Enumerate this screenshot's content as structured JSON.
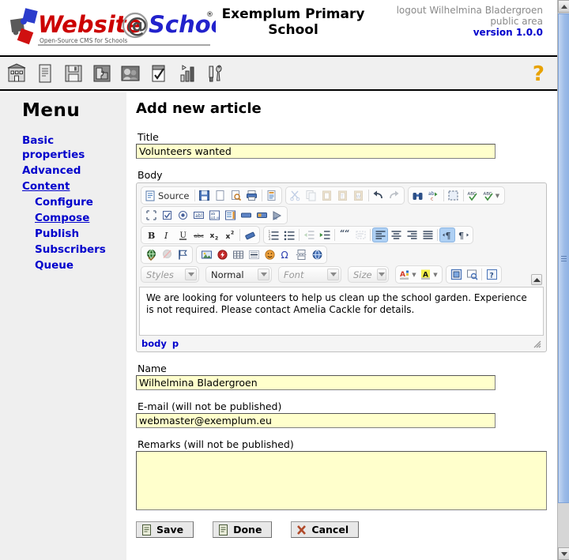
{
  "header": {
    "logo_text_1": "Website",
    "logo_at": "@",
    "logo_text_2": "School",
    "logo_tagline": "Open-Source CMS for Schools",
    "registered_mark": "®",
    "site_title": "Exemplum Primary School",
    "logout_text": "logout Wilhelmina Bladergroen",
    "area_text": "public area",
    "version_text": "version 1.0.0"
  },
  "iconbar": {
    "items": [
      {
        "name": "school-home-icon",
        "title": "School"
      },
      {
        "name": "page-icon",
        "title": "Pages"
      },
      {
        "name": "floppy-disk-icon",
        "title": "Save / Files"
      },
      {
        "name": "modules-puzzle-icon",
        "title": "Modules"
      },
      {
        "name": "users-icon",
        "title": "Users"
      },
      {
        "name": "checklist-icon",
        "title": "Tasks"
      },
      {
        "name": "statistics-icon",
        "title": "Statistics"
      },
      {
        "name": "tools-icon",
        "title": "Tools"
      }
    ],
    "help_label": "?"
  },
  "sidebar": {
    "title": "Menu",
    "items": [
      {
        "label": "Basic properties",
        "active": false,
        "sub": false
      },
      {
        "label": "Advanced",
        "active": false,
        "sub": false
      },
      {
        "label": "Content",
        "active": true,
        "sub": false
      },
      {
        "label": "Configure",
        "active": false,
        "sub": true
      },
      {
        "label": "Compose",
        "active": true,
        "sub": true
      },
      {
        "label": "Publish",
        "active": false,
        "sub": true
      },
      {
        "label": "Subscribers",
        "active": false,
        "sub": true
      },
      {
        "label": "Queue",
        "active": false,
        "sub": true
      }
    ]
  },
  "main": {
    "page_title": "Add new article",
    "fields": {
      "title_label": "Title",
      "title_value": "Volunteers wanted",
      "body_label": "Body",
      "name_label": "Name",
      "name_value": "Wilhelmina Bladergroen",
      "email_label": "E-mail (will not be published)",
      "email_value": "webmaster@exemplum.eu",
      "remarks_label": "Remarks (will not be published)",
      "remarks_value": ""
    },
    "editor": {
      "source_label": "Source",
      "content_line_1": "We are looking for volunteers to help us clean up the school garden. Experience is not required.",
      "content_line_2": "Please contact Amelia Cackle for details.",
      "path": [
        "body",
        "p"
      ],
      "combos": [
        {
          "name": "styles-combo",
          "label": "Styles",
          "set": false
        },
        {
          "name": "format-combo",
          "label": "Normal",
          "set": true
        },
        {
          "name": "font-combo",
          "label": "Font",
          "set": false
        },
        {
          "name": "fontsize-combo",
          "label": "Size",
          "set": false
        }
      ],
      "row1": [
        [
          "source"
        ],
        [
          "save",
          "new-page",
          "preview",
          "print",
          "templates"
        ],
        [
          "cut",
          "copy",
          "paste",
          "paste-text",
          "paste-word",
          "undo",
          "redo"
        ],
        [
          "find",
          "replace",
          "select-all",
          "spellcheck",
          "spellcheck-options"
        ]
      ],
      "row2": [
        [
          "form",
          "checkbox",
          "radio",
          "text-field",
          "textarea",
          "select-field",
          "button",
          "image-button",
          "hidden-field"
        ]
      ],
      "row3": [
        [
          "bold",
          "italic",
          "underline",
          "strike",
          "subscript",
          "superscript",
          "remove-format"
        ],
        [
          "numbered-list",
          "bulleted-list",
          "outdent",
          "indent",
          "blockquote",
          "create-div",
          "align-left",
          "align-center",
          "align-right",
          "align-justify",
          "ltr",
          "rtl"
        ]
      ],
      "row4": [
        [
          "link",
          "unlink",
          "anchor"
        ],
        [
          "image",
          "flash",
          "table",
          "horizontal-rule",
          "smiley",
          "special-char",
          "page-break",
          "iframe"
        ]
      ],
      "row5_extra": [
        "text-color",
        "bg-color",
        "show-blocks",
        "maximize",
        "about"
      ]
    }
  },
  "buttons": [
    {
      "name": "save-button",
      "label": "Save",
      "icon": "document-icon"
    },
    {
      "name": "done-button",
      "label": "Done",
      "icon": "document-icon"
    },
    {
      "name": "cancel-button",
      "label": "Cancel",
      "icon": "cross-icon"
    }
  ],
  "colors": {
    "accent_blue": "#0000cc",
    "input_yellow": "#ffffcc",
    "sidebar_grey": "#efefef",
    "iconbar_grey": "#f0f0f0",
    "help_orange": "#e8a200",
    "logo_red": "#cc0000",
    "logo_blue": "#2222cc",
    "active_toolbar_blue": "#aed0f4",
    "scrollbar_blue": "#9cbbe8"
  }
}
